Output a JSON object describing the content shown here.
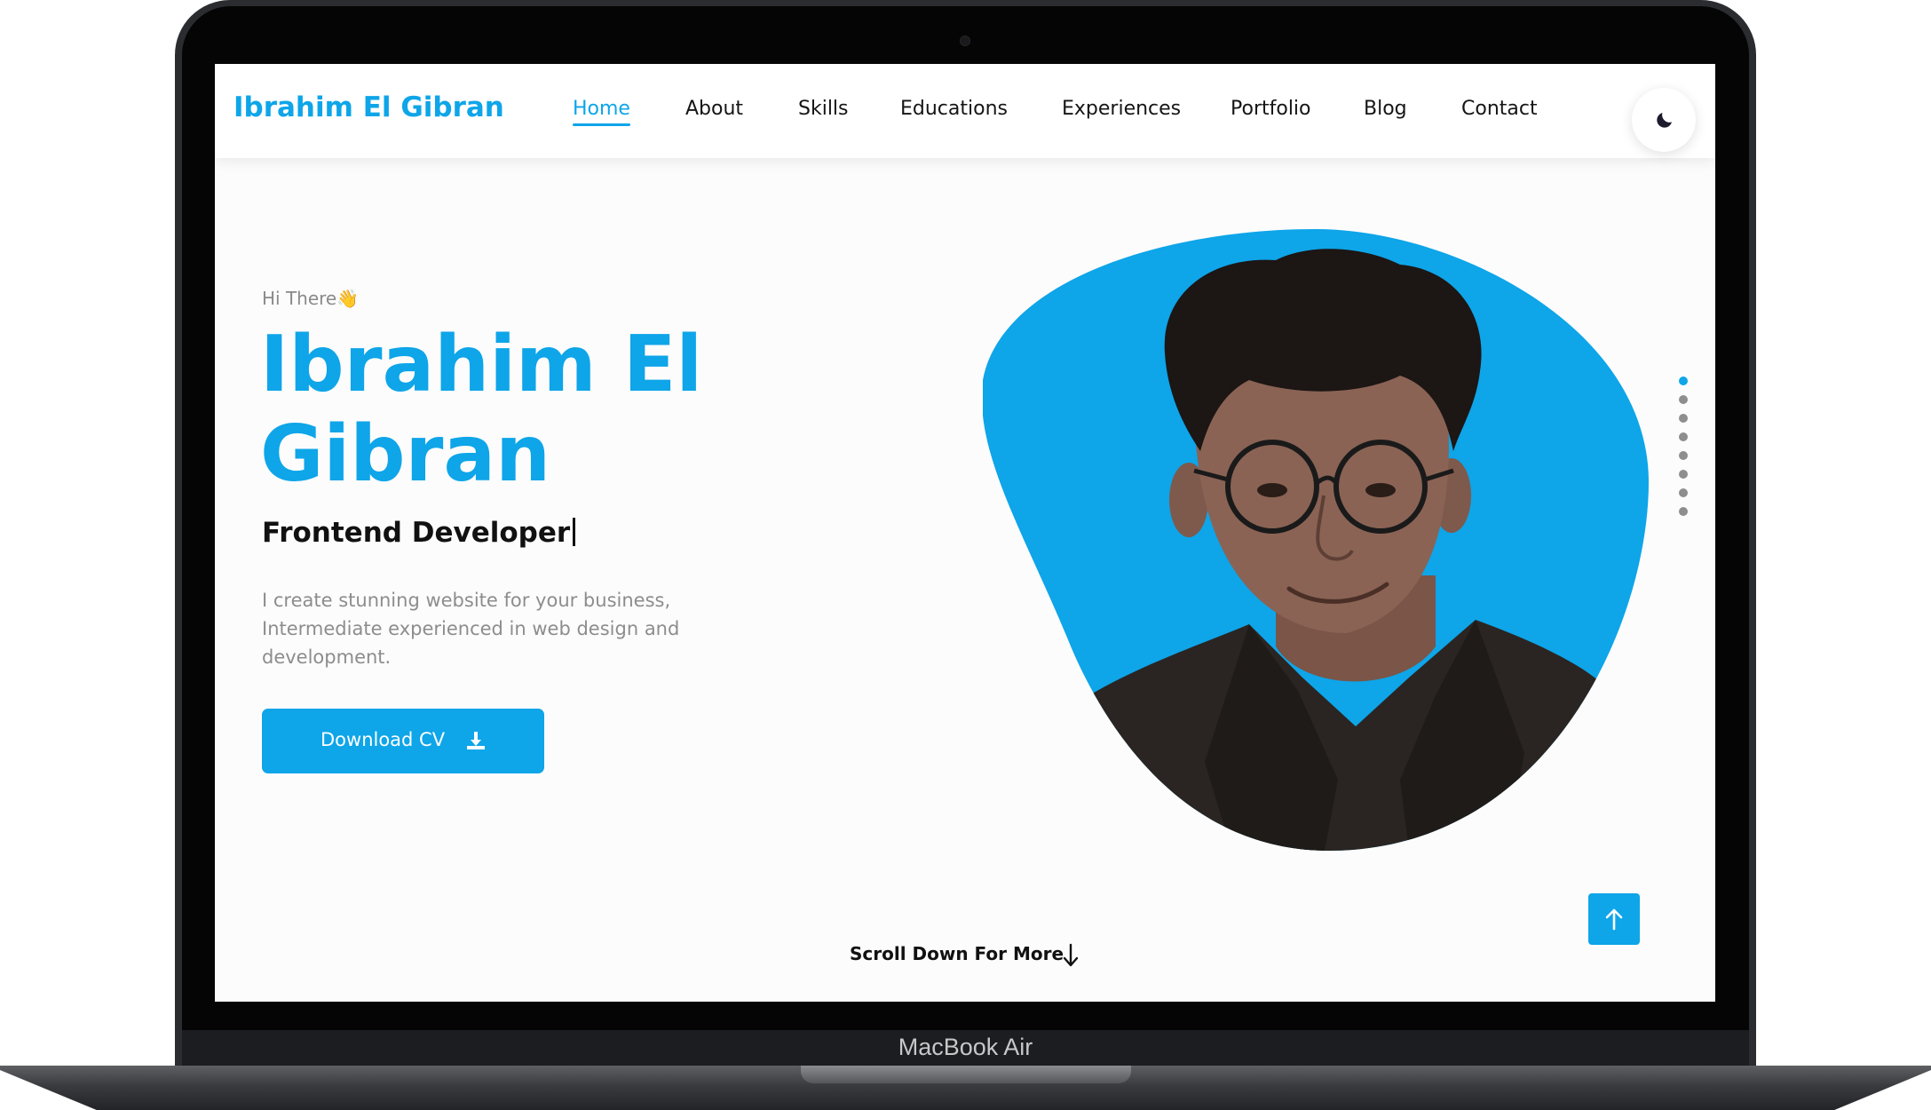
{
  "device": {
    "model_label": "MacBook Air"
  },
  "header": {
    "brand": "Ibrahim El Gibran",
    "nav": [
      {
        "label": "Home",
        "active": true
      },
      {
        "label": "About",
        "active": false
      },
      {
        "label": "Skills",
        "active": false
      },
      {
        "label": "Educations",
        "active": false
      },
      {
        "label": "Experiences",
        "active": false
      },
      {
        "label": "Portfolio",
        "active": false
      },
      {
        "label": "Blog",
        "active": false
      },
      {
        "label": "Contact",
        "active": false
      }
    ],
    "theme_toggle_icon": "moon-icon"
  },
  "hero": {
    "greeting": "Hi There👋",
    "name": "Ibrahim El Gibran",
    "title": "Frontend Developer",
    "description": "I create stunning website for your business, Intermediate experienced in web design and development.",
    "download_label": "Download CV",
    "download_icon": "download-icon",
    "profile_icon": "profile-photo"
  },
  "side_nav": {
    "count": 8,
    "active_index": 0
  },
  "scroll_down": {
    "label": "Scroll Down For More",
    "icon": "arrow-down-icon"
  },
  "scroll_top": {
    "icon": "arrow-up-icon"
  },
  "colors": {
    "accent": "#0ea5e9",
    "text": "#111111",
    "muted": "#8d8d8d",
    "background": "#fcfcfc"
  }
}
